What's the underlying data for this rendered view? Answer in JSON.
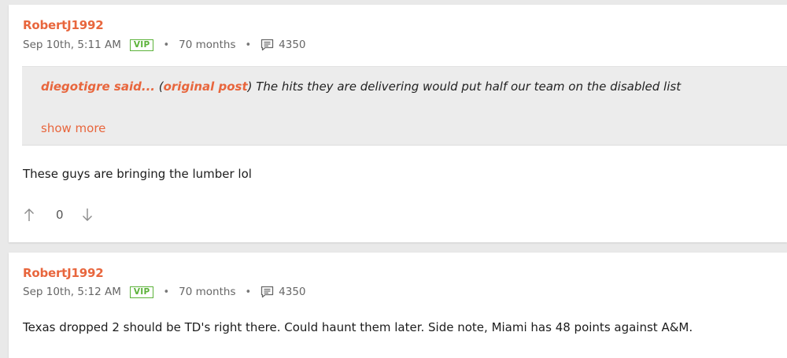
{
  "colors": {
    "accent": "#e8663d",
    "vip": "#5cb23a",
    "page_bg": "#e9e9e9",
    "quote_bg": "#ececec"
  },
  "posts": [
    {
      "username": "RobertJ1992",
      "timestamp": "Sep 10th, 5:11 AM",
      "badge": "VIP",
      "tenure": "70 months",
      "post_count": "4350",
      "quote": {
        "author": "diegotigre said...",
        "link_label": "original post",
        "text": "The hits they are delivering would put half our team on the disabled list",
        "show_more": "show more"
      },
      "body": "These guys are bringing the lumber lol",
      "score": "0"
    },
    {
      "username": "RobertJ1992",
      "timestamp": "Sep 10th, 5:12 AM",
      "badge": "VIP",
      "tenure": "70 months",
      "post_count": "4350",
      "body": "Texas dropped 2 should be TD's right there. Could haunt them later. Side note, Miami has 48 points against A&M."
    }
  ],
  "icons": {
    "post_count": "message-icon",
    "upvote": "arrow-up-icon",
    "downvote": "arrow-down-icon"
  }
}
